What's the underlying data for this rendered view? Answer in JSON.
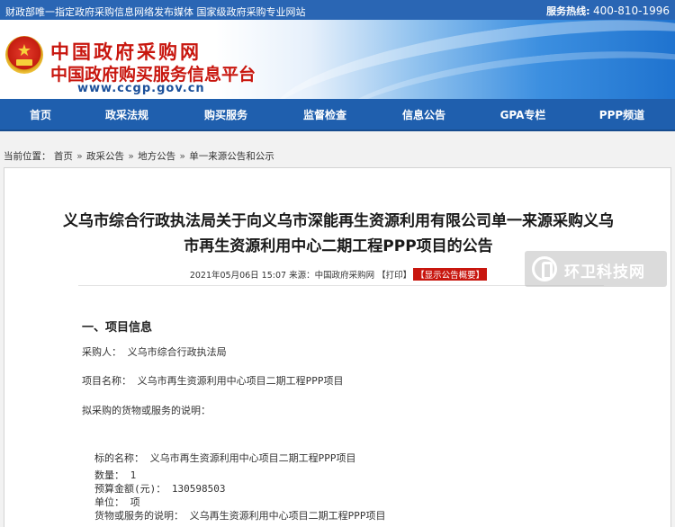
{
  "topbar": {
    "left_text": "财政部唯一指定政府采购信息网络发布媒体 国家级政府采购专业网站",
    "hotline_label": "服务热线:",
    "hotline_number": "400-810-1996"
  },
  "header": {
    "title_main": "中国政府采购网",
    "title_sub": "中国政府购买服务信息平台",
    "url": "www.ccgp.gov.cn",
    "emblem_icon": "national-emblem-icon",
    "banner_color": "#1f73cf",
    "title_color": "#c8160e"
  },
  "nav": {
    "items": [
      {
        "label": "首页"
      },
      {
        "label": "政采法规"
      },
      {
        "label": "购买服务"
      },
      {
        "label": "监督检查"
      },
      {
        "label": "信息公告"
      },
      {
        "label": "GPA专栏"
      },
      {
        "label": "PPP频道"
      }
    ],
    "bg_color": "#1f5fae"
  },
  "breadcrumb": {
    "prefix": "当前位置：",
    "items": [
      "首页",
      "政采公告",
      "地方公告",
      "单一来源公告和公示"
    ],
    "separator": "»"
  },
  "article": {
    "title_line1": "义乌市综合行政执法局关于向义乌市深能再生资源利用有限公司单一来源采购义乌",
    "title_line2": "市再生资源利用中心二期工程PPP项目的公告",
    "meta": {
      "date": "2021年05月06日 15:07",
      "source": "来源：中国政府采购网",
      "print_label": "【打印】",
      "summary_label": "【显示公告概要】"
    },
    "section1_title": "一、项目信息",
    "purchaser": "采购人：  义乌市综合行政执法局",
    "project_name": "项目名称：  义乌市再生资源利用中心项目二期工程PPP项目",
    "goods_desc_label": "拟采购的货物或服务的说明：",
    "lot": {
      "name": "标的名称：  义乌市再生资源利用中心项目二期工程PPP项目",
      "quantity": "数量：  1",
      "budget": "预算金额(元)：  130598503",
      "unit": "单位：  项",
      "desc": "货物或服务的说明：  义乌再生资源利用中心项目二期工程PPP项目"
    }
  },
  "watermark": {
    "icon": "huanwei-logo-icon",
    "text": "环卫科技网"
  }
}
